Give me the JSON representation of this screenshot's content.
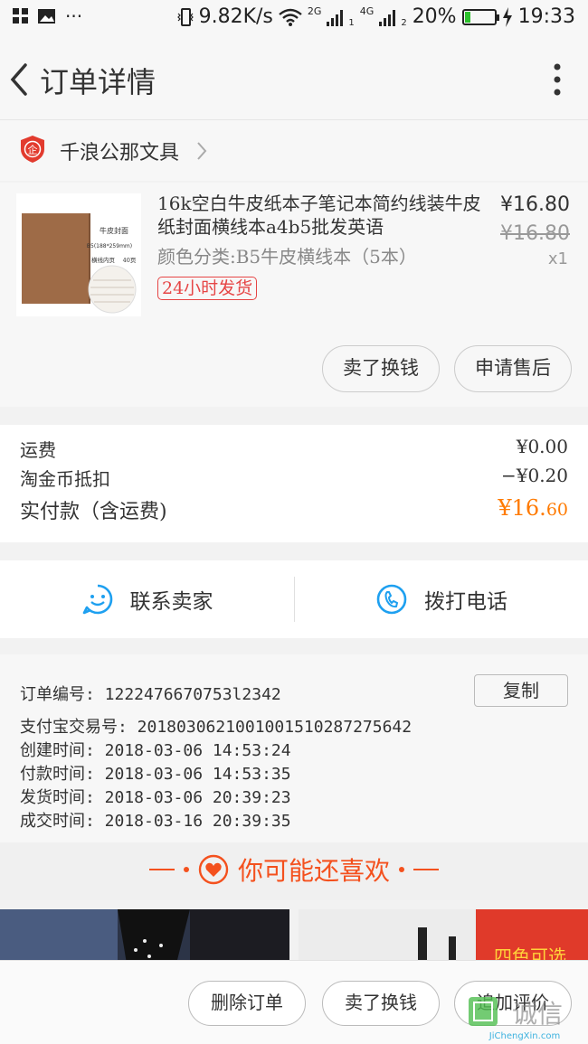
{
  "status_bar": {
    "speed": "9.82K/s",
    "network_2g": "2G",
    "network_4g": "4G",
    "sim1": "1",
    "sim2": "2",
    "battery": "20%",
    "battery_level": 0.2,
    "time": "19:33"
  },
  "header": {
    "title": "订单详情"
  },
  "shop": {
    "name": "千浪公那文具",
    "logo_char": "企"
  },
  "product": {
    "title": "16k空白牛皮纸本子笔记本简约线装牛皮纸封面横线本a4b5批发英语",
    "variant": "颜色分类:B5牛皮横线本（5本）",
    "tag": "24小时发货",
    "price": "¥16.80",
    "original_price": "¥16.80",
    "quantity": "x1",
    "thumb_text": {
      "title": "牛皮封面",
      "size": "B5(188*259mm)",
      "lines": "横线内页",
      "pages": "40页"
    },
    "actions": [
      "卖了换钱",
      "申请售后"
    ]
  },
  "costs": {
    "shipping_label": "运费",
    "shipping_value": "¥0.00",
    "coin_label": "淘金币抵扣",
    "coin_value": "−¥0.20",
    "total_label": "实付款（含运费)",
    "total_value_main": "¥16.",
    "total_value_cents": "60"
  },
  "contact": {
    "seller": "联系卖家",
    "phone": "拨打电话"
  },
  "order_info": {
    "order_no": "订单编号:  1222476670753l2342",
    "copy": "复制",
    "alipay": "支付宝交易号:  2018030621001001510287275642",
    "created": "创建时间:  2018-03-06  14:53:24",
    "paid": "付款时间:  2018-03-06  14:53:35",
    "shipped": "发货时间:  2018-03-06  20:39:23",
    "done": "成交时间:  2018-03-16  20:39:35"
  },
  "recommend": {
    "title": "你可能还喜欢",
    "banner_text": "四色可选"
  },
  "bottom_bar": {
    "delete": "删除订单",
    "sell": "卖了换钱",
    "review": "追加评价"
  },
  "watermark": {
    "cn": "诚信",
    "en": "JiChengXin.com"
  },
  "colors": {
    "accent": "#ff7a00",
    "tag_red": "#e64545",
    "contact_blue": "#1ea0f0",
    "guess_orange": "#f4511e"
  }
}
